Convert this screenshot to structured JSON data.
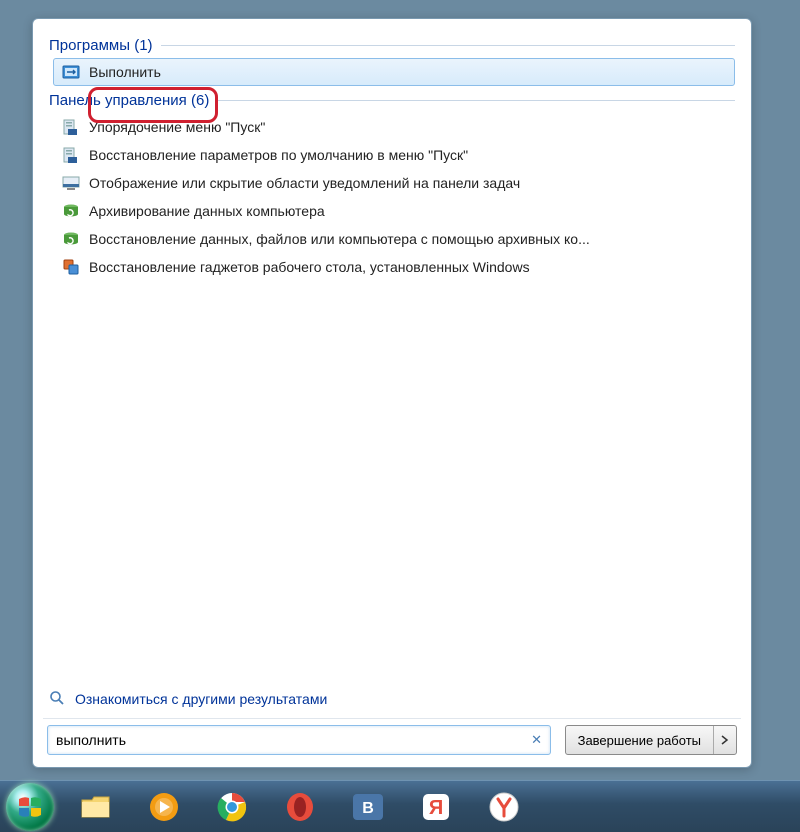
{
  "categories": {
    "programs": {
      "label": "Программы",
      "count": 1
    },
    "control_panel": {
      "label": "Панель управления",
      "count": 6
    }
  },
  "results": {
    "programs": [
      {
        "label": "Выполнить",
        "icon": "run-icon"
      }
    ],
    "control_panel": [
      {
        "label": "Упорядочение меню \"Пуск\"",
        "icon": "startmenu-config-icon"
      },
      {
        "label": "Восстановление параметров по умолчанию в меню \"Пуск\"",
        "icon": "startmenu-config-icon"
      },
      {
        "label": "Отображение или скрытие области уведомлений на панели задач",
        "icon": "taskbar-config-icon"
      },
      {
        "label": "Архивирование данных компьютера",
        "icon": "backup-icon"
      },
      {
        "label": "Восстановление данных, файлов или компьютера с помощью архивных ко...",
        "icon": "backup-icon"
      },
      {
        "label": "Восстановление гаджетов рабочего стола, установленных Windows",
        "icon": "gadgets-icon"
      }
    ]
  },
  "more_results": {
    "label": "Ознакомиться с другими результатами"
  },
  "search": {
    "value": "выполнить"
  },
  "shutdown": {
    "label": "Завершение работы"
  },
  "taskbar": {
    "items": [
      {
        "name": "start-button",
        "icon": "windows-orb"
      },
      {
        "name": "file-explorer",
        "icon": "explorer-icon"
      },
      {
        "name": "media-player",
        "icon": "wmp-icon"
      },
      {
        "name": "chrome",
        "icon": "chrome-icon"
      },
      {
        "name": "opera",
        "icon": "opera-icon"
      },
      {
        "name": "vk",
        "icon": "vk-icon"
      },
      {
        "name": "yandex-app",
        "icon": "yandex-red-icon"
      },
      {
        "name": "yandex-browser",
        "icon": "yandex-y-icon"
      }
    ]
  }
}
